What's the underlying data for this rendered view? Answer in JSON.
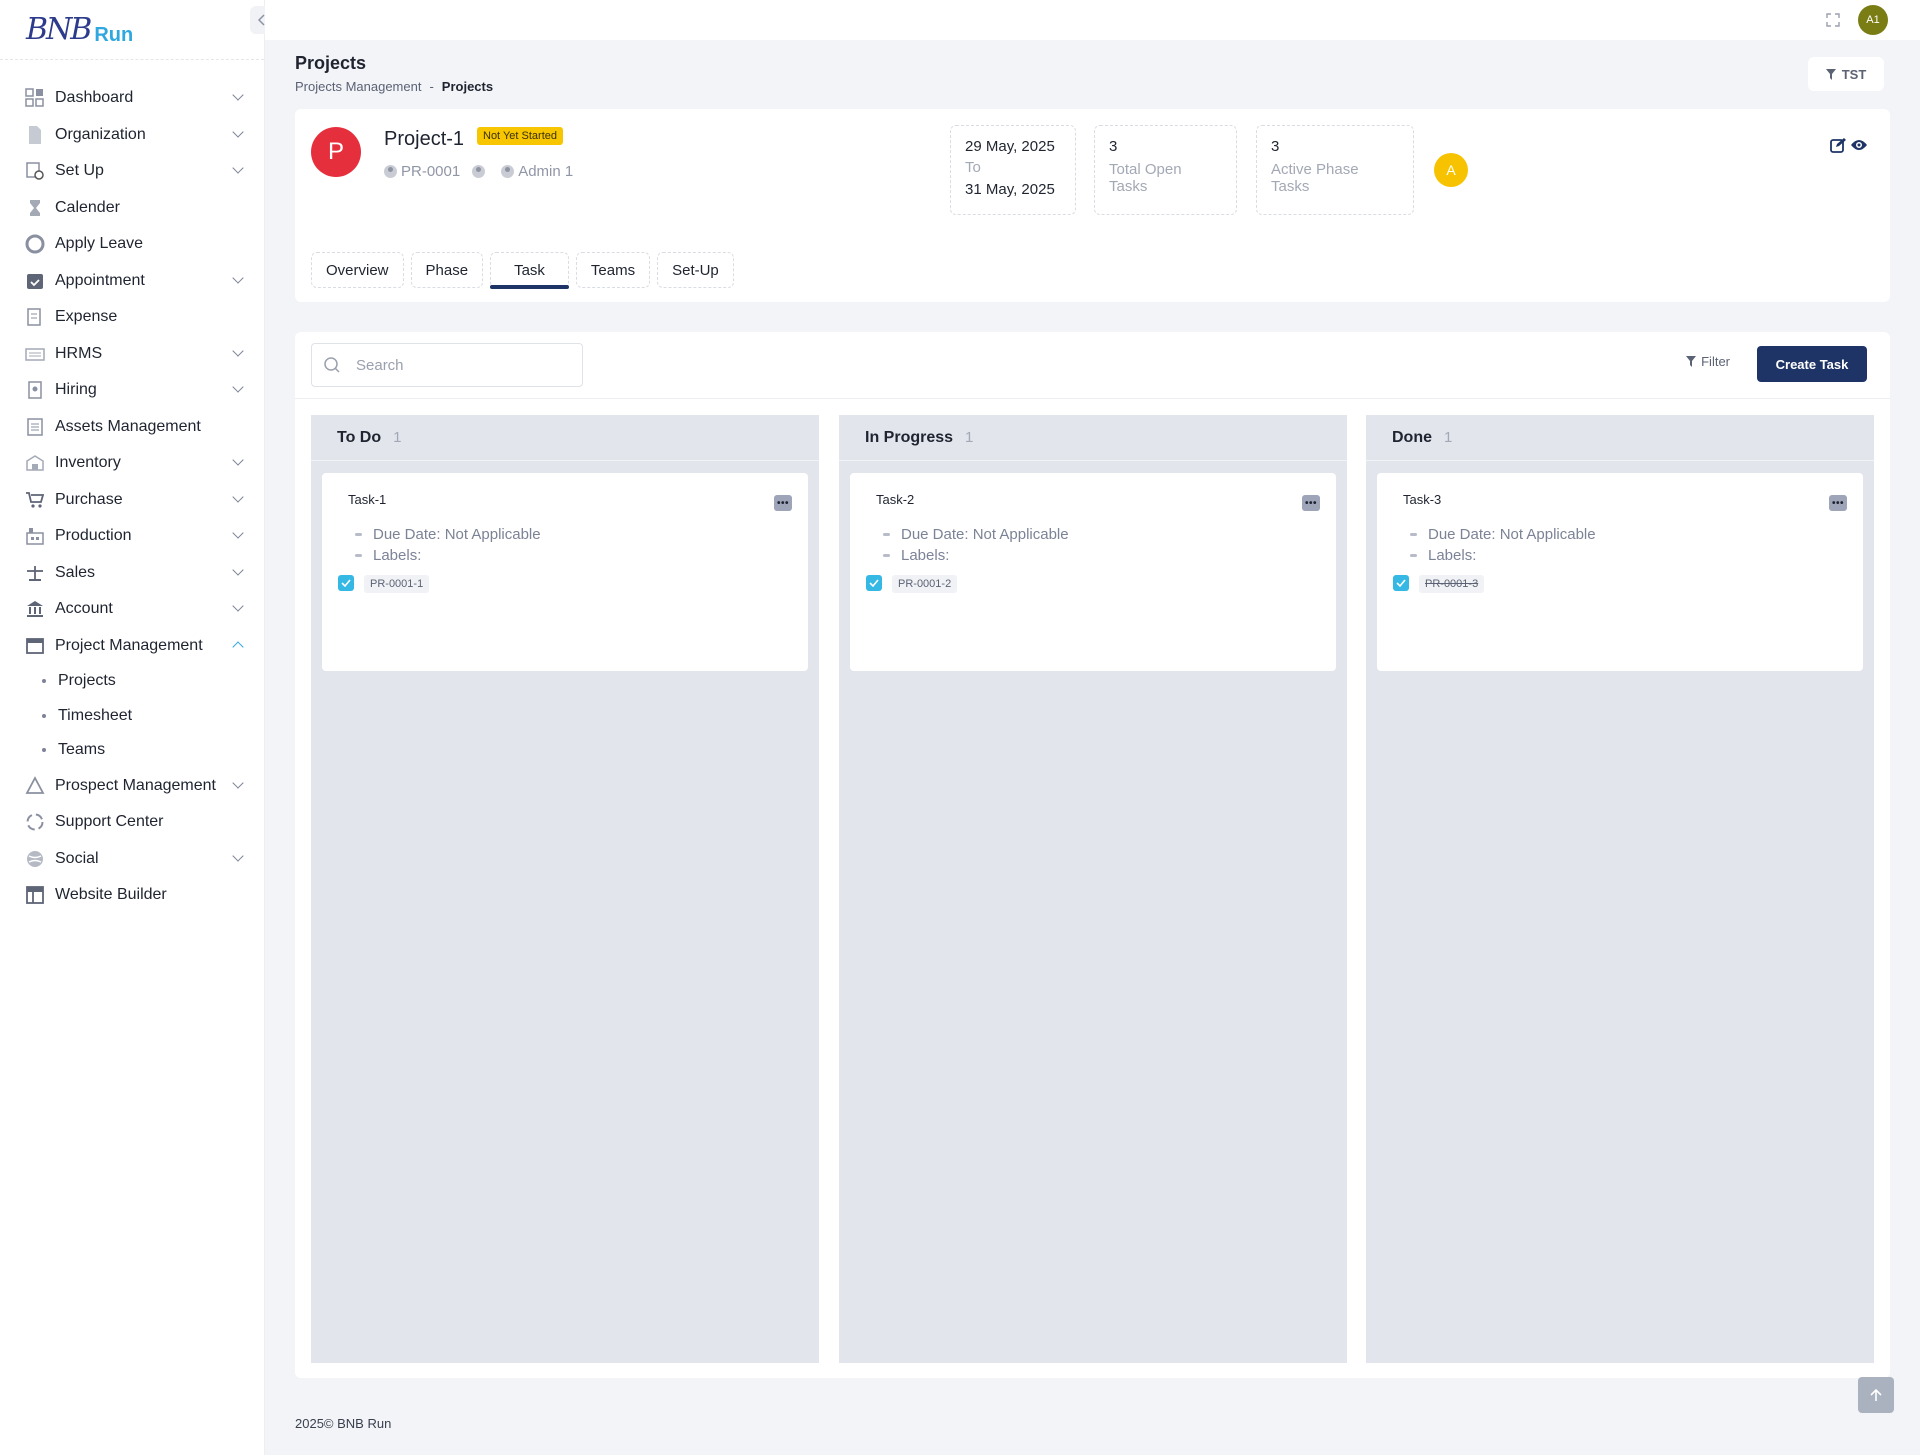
{
  "brand": {
    "mark": "BNB",
    "run": "Run"
  },
  "sidebar": {
    "items": [
      {
        "label": "Dashboard",
        "expandable": true
      },
      {
        "label": "Organization",
        "expandable": true
      },
      {
        "label": "Set Up",
        "expandable": true
      },
      {
        "label": "Calender",
        "expandable": false
      },
      {
        "label": "Apply Leave",
        "expandable": false
      },
      {
        "label": "Appointment",
        "expandable": true
      },
      {
        "label": "Expense",
        "expandable": false
      },
      {
        "label": "HRMS",
        "expandable": true
      },
      {
        "label": "Hiring",
        "expandable": true
      },
      {
        "label": "Assets Management",
        "expandable": false
      },
      {
        "label": "Inventory",
        "expandable": true
      },
      {
        "label": "Purchase",
        "expandable": true
      },
      {
        "label": "Production",
        "expandable": true
      },
      {
        "label": "Sales",
        "expandable": true
      },
      {
        "label": "Account",
        "expandable": true
      },
      {
        "label": "Project Management",
        "expandable": true,
        "open": true
      },
      {
        "label": "Prospect Management",
        "expandable": true
      },
      {
        "label": "Support Center",
        "expandable": false
      },
      {
        "label": "Social",
        "expandable": true
      },
      {
        "label": "Website Builder",
        "expandable": false
      }
    ],
    "subitems": [
      "Projects",
      "Timesheet",
      "Teams"
    ]
  },
  "topbar": {
    "user_initials": "A1"
  },
  "page": {
    "title": "Projects",
    "breadcrumb": [
      "Projects Management",
      "-",
      "Projects"
    ],
    "filter_chip": "TST"
  },
  "project": {
    "avatar_letter": "P",
    "name": "Project-1",
    "status": "Not Yet Started",
    "code": "PR-0001",
    "owner": "Admin 1",
    "date_start": "29 May, 2025",
    "date_to": "To",
    "date_end": "31 May, 2025",
    "open_tasks_count": "3",
    "open_tasks_label": "Total Open Tasks",
    "phase_tasks_count": "3",
    "phase_tasks_label": "Active Phase Tasks",
    "member_initial": "A"
  },
  "tabs": [
    "Overview",
    "Phase",
    "Task",
    "Teams",
    "Set-Up"
  ],
  "active_tab": "Task",
  "board": {
    "search_placeholder": "Search",
    "filter_label": "Filter",
    "create_label": "Create Task",
    "columns": [
      {
        "title": "To Do",
        "count": "1",
        "task": {
          "name": "Task-1",
          "due": "Due Date: Not Applicable",
          "labels": "Labels:",
          "code": "PR-0001-1",
          "done": false
        }
      },
      {
        "title": "In Progress",
        "count": "1",
        "task": {
          "name": "Task-2",
          "due": "Due Date: Not Applicable",
          "labels": "Labels:",
          "code": "PR-0001-2",
          "done": false
        }
      },
      {
        "title": "Done",
        "count": "1",
        "task": {
          "name": "Task-3",
          "due": "Due Date: Not Applicable",
          "labels": "Labels:",
          "code": "PR-0001-3",
          "done": true
        }
      }
    ]
  },
  "footer": "2025© BNB Run",
  "colors": {
    "primary": "#1f3466",
    "accent": "#2fa8e0",
    "status": "#f7c600",
    "avatar": "#e62f3d"
  }
}
